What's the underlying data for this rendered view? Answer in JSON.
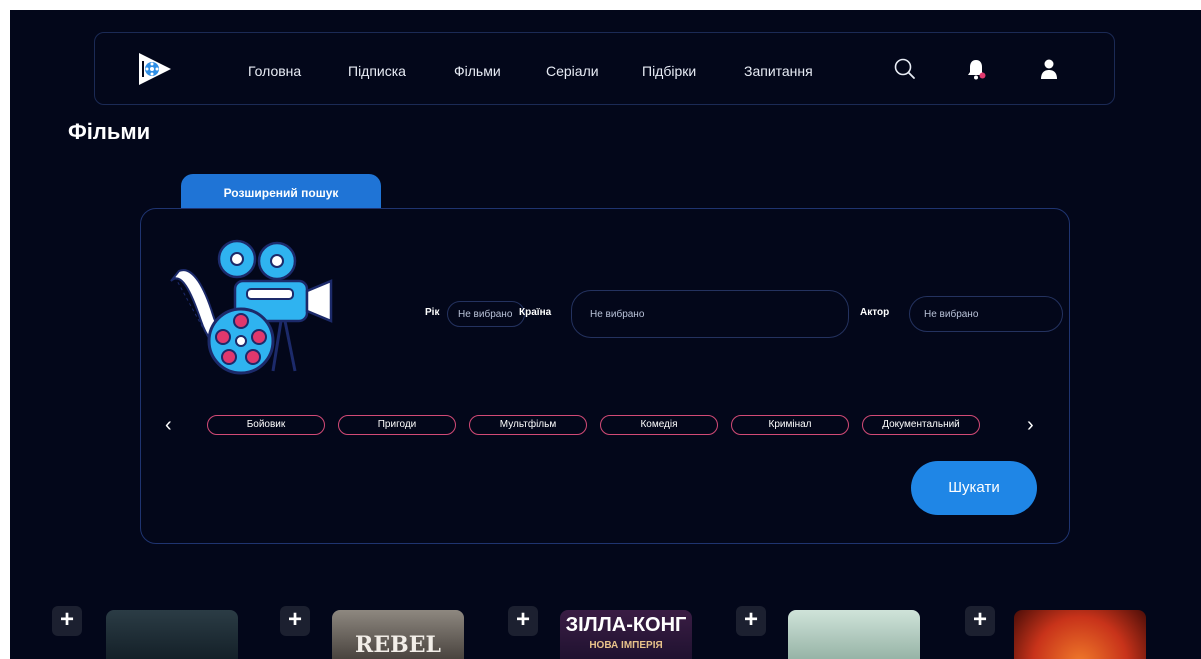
{
  "nav": {
    "items": [
      "Головна",
      "Підписка",
      "Фільми",
      "Серіали",
      "Підбірки",
      "Запитання"
    ]
  },
  "icons": {
    "logo": "play-film-logo-icon",
    "search": "search-icon",
    "notifications": "bell-icon",
    "profile": "user-icon"
  },
  "colors": {
    "background": "#03071a",
    "accent": "#1f86e6",
    "chip_border": "#d24a76",
    "notification_dot": "#e0386d"
  },
  "page": {
    "title": "Фільми"
  },
  "search": {
    "tab_label": "Розширений пошук",
    "year_label": "Рік",
    "year_value": "Не вибрано",
    "country_label": "Країна",
    "country_value": "Не вибрано",
    "actor_label": "Актор",
    "actor_value": "Не вибрано",
    "genres": [
      "Бойовик",
      "Пригоди",
      "Мультфільм",
      "Комедія",
      "Кримінал",
      "Документальний"
    ],
    "submit_label": "Шукати"
  },
  "posters": [
    {
      "title": ""
    },
    {
      "title": "REBEL"
    },
    {
      "title": "ЗІЛЛА-КОНГ",
      "subtitle": "НОВА ІМПЕРІЯ"
    },
    {
      "title": ""
    },
    {
      "title": ""
    }
  ]
}
